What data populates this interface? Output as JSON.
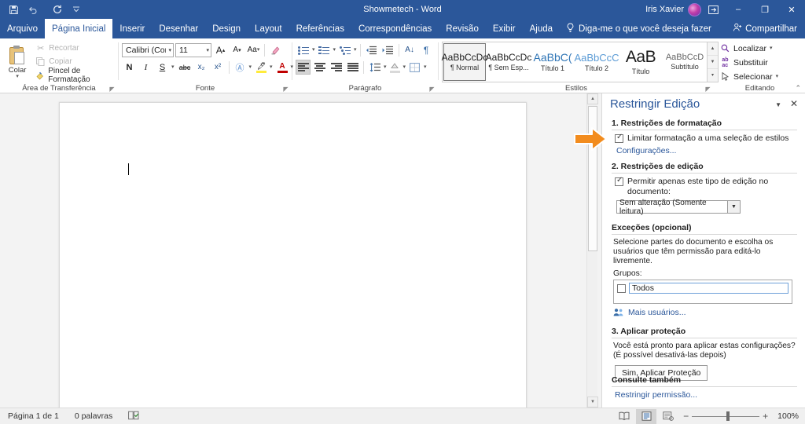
{
  "titlebar": {
    "quick_access": [
      {
        "name": "save-icon",
        "label": "Salvar"
      },
      {
        "name": "undo-icon",
        "label": "Desfazer"
      },
      {
        "name": "redo-icon",
        "label": "Refazer"
      },
      {
        "name": "customize-qat-icon",
        "label": "Personalizar Barra de Ferramentas de Acesso Rápido"
      }
    ],
    "document_title": "Showmetech  -  Word",
    "user_name": "Iris Xavier",
    "ribbon_display_icon": "ribbon-display-options-icon",
    "minimize": "–",
    "restore": "❐",
    "close": "✕"
  },
  "tabs": [
    {
      "label": "Arquivo",
      "active": false
    },
    {
      "label": "Página Inicial",
      "active": true
    },
    {
      "label": "Inserir",
      "active": false
    },
    {
      "label": "Desenhar",
      "active": false
    },
    {
      "label": "Design",
      "active": false
    },
    {
      "label": "Layout",
      "active": false
    },
    {
      "label": "Referências",
      "active": false
    },
    {
      "label": "Correspondências",
      "active": false
    },
    {
      "label": "Revisão",
      "active": false
    },
    {
      "label": "Exibir",
      "active": false
    },
    {
      "label": "Ajuda",
      "active": false
    }
  ],
  "tell_me": "Diga-me o que você deseja fazer",
  "share_label": "Compartilhar",
  "ribbon": {
    "clipboard": {
      "group_label": "Área de Transferência",
      "paste_label": "Colar",
      "commands": [
        {
          "label": "Recortar",
          "icon": "scissors-icon",
          "enabled": false
        },
        {
          "label": "Copiar",
          "icon": "copy-icon",
          "enabled": false
        },
        {
          "label": "Pincel de Formatação",
          "icon": "format-painter-icon",
          "enabled": true
        }
      ]
    },
    "font": {
      "group_label": "Fonte",
      "font_name": "Calibri (Corpo",
      "font_size": "11",
      "buttons_row1": [
        {
          "name": "grow-font-icon",
          "label": "A"
        },
        {
          "name": "shrink-font-icon",
          "label": "A"
        },
        {
          "name": "change-case-icon",
          "label": "Aa"
        },
        {
          "name": "clear-formatting-icon",
          "label": "✐"
        }
      ],
      "buttons_row2": [
        {
          "name": "bold-icon",
          "label": "N"
        },
        {
          "name": "italic-icon",
          "label": "I"
        },
        {
          "name": "underline-icon",
          "label": "S"
        },
        {
          "name": "strikethrough-icon",
          "label": "abc"
        },
        {
          "name": "subscript-icon",
          "label": "x₂"
        },
        {
          "name": "superscript-icon",
          "label": "x²"
        }
      ],
      "buttons_row3": [
        {
          "name": "text-effects-icon",
          "label": "A"
        },
        {
          "name": "text-highlight-icon",
          "label": "ab"
        },
        {
          "name": "font-color-icon",
          "label": "A"
        }
      ]
    },
    "paragraph": {
      "group_label": "Parágrafo",
      "row1": [
        {
          "name": "bullets-icon"
        },
        {
          "name": "numbering-icon"
        },
        {
          "name": "multilevel-list-icon"
        },
        {
          "name": "decrease-indent-icon"
        },
        {
          "name": "increase-indent-icon"
        },
        {
          "name": "sort-icon"
        },
        {
          "name": "show-formatting-marks-icon",
          "label": "¶"
        }
      ],
      "row2": [
        {
          "name": "align-left-icon"
        },
        {
          "name": "align-center-icon"
        },
        {
          "name": "align-right-icon"
        },
        {
          "name": "justify-icon"
        },
        {
          "name": "line-spacing-icon"
        },
        {
          "name": "shading-icon"
        },
        {
          "name": "borders-icon"
        }
      ]
    },
    "styles": {
      "group_label": "Estilos",
      "items": [
        {
          "preview": "AaBbCcDc",
          "name": "¶ Normal",
          "selected": true
        },
        {
          "preview": "AaBbCcDc",
          "name": "¶ Sem Esp...",
          "selected": false
        },
        {
          "preview": "AaBbC(",
          "name": "Título 1",
          "selected": false
        },
        {
          "preview": "AaBbCcC",
          "name": "Título 2",
          "selected": false
        },
        {
          "preview": "AaB",
          "name": "Título",
          "selected": false
        },
        {
          "preview": "AaBbCcD",
          "name": "Subtítulo",
          "selected": false
        }
      ]
    },
    "editing": {
      "group_label": "Editando",
      "commands": [
        {
          "label": "Localizar",
          "icon": "search-icon",
          "has_caret": true
        },
        {
          "label": "Substituir",
          "icon": "replace-icon",
          "has_caret": false
        },
        {
          "label": "Selecionar",
          "icon": "select-cursor-icon",
          "has_caret": true
        }
      ]
    }
  },
  "pane": {
    "title": "Restringir Edição",
    "collapse_icon": "chevron-down-icon",
    "close_icon": "close-icon",
    "section1": {
      "heading": "1. Restrições de formatação",
      "checkbox_label": "Limitar formatação a uma seleção de estilos",
      "checkbox_checked": true,
      "settings_link": "Configurações..."
    },
    "section2": {
      "heading": "2. Restrições de edição",
      "checkbox_label": "Permitir apenas este tipo de edição no documento:",
      "checkbox_checked": true,
      "select_value": "Sem alteração (Somente leitura)",
      "exceptions_heading": "Exceções (opcional)",
      "exceptions_text": "Selecione partes do documento e escolha os usuários que têm permissão para editá-lo livremente.",
      "groups_label": "Grupos:",
      "group_item": "Todos",
      "group_item_checked": false,
      "more_users_link": "Mais usuários...",
      "more_users_icon": "users-icon"
    },
    "section3": {
      "heading": "3. Aplicar proteção",
      "text": "Você está pronto para aplicar estas configurações? (É possível desativá-las depois)",
      "button_label": "Sim, Aplicar Proteção"
    },
    "see_also": {
      "heading": "Consulte também",
      "link": "Restringir permissão..."
    }
  },
  "callout": {
    "name": "orange-arrow-annotation",
    "color": "#f28c1e"
  },
  "status": {
    "page_info": "Página 1 de 1",
    "word_count": "0 palavras",
    "proofing_icon": "proofing-status-icon",
    "views": [
      {
        "name": "read-mode-icon",
        "active": false
      },
      {
        "name": "print-layout-icon",
        "active": true
      },
      {
        "name": "web-layout-icon",
        "active": false
      }
    ],
    "zoom_out": "−",
    "zoom_in": "+",
    "zoom_level": "100%"
  },
  "colors": {
    "titlebar": "#2b579a",
    "pane_title": "#2b579a",
    "link": "#2b579a",
    "accent_orange": "#f28c1e"
  }
}
